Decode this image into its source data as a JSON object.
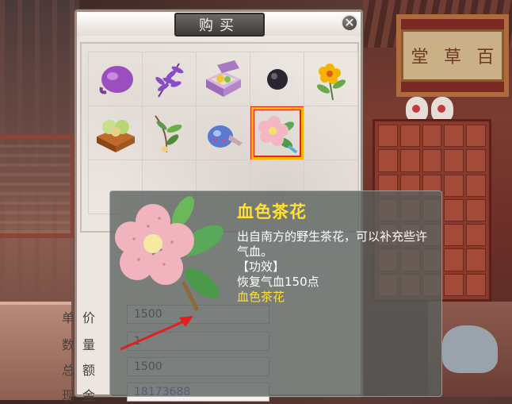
{
  "window": {
    "title": "购买",
    "close_glyph": "✕"
  },
  "scene": {
    "signboard_chars": [
      "堂",
      "草",
      "百"
    ]
  },
  "items": [
    {
      "name": "purple-bean-pouch",
      "icon": "purple-pouch-icon"
    },
    {
      "name": "purple-herb",
      "icon": "purple-herb-icon"
    },
    {
      "name": "food-box",
      "icon": "food-box-icon"
    },
    {
      "name": "black-pill",
      "icon": "black-pill-icon"
    },
    {
      "name": "yellow-flower",
      "icon": "yellow-flower-icon"
    },
    {
      "name": "green-buns",
      "icon": "green-buns-icon"
    },
    {
      "name": "sprig",
      "icon": "sprig-icon"
    },
    {
      "name": "blue-gourd",
      "icon": "blue-gourd-icon"
    },
    {
      "name": "camellia",
      "icon": "camellia-icon",
      "selected": true
    }
  ],
  "tooltip": {
    "title": "血色茶花",
    "description": "出自南方的野生茶花，可以补充些许气血。",
    "effect_header": "【功效】",
    "effect": "恢复气血150点",
    "footer": "血色茶花"
  },
  "form": {
    "price_label": "单价",
    "price_value": "1500",
    "quantity_label": "数量",
    "quantity_value": "1",
    "total_label": "总额",
    "total_value": "1500",
    "cash_label": "现金",
    "cash_value": "18173688"
  },
  "colors": {
    "tooltip_title": "#ffe033",
    "selected_border": "#f2b600",
    "selected_inner": "#d92a1e",
    "cash_value": "#6a3fd0",
    "annotation_arrow": "#e02020"
  }
}
